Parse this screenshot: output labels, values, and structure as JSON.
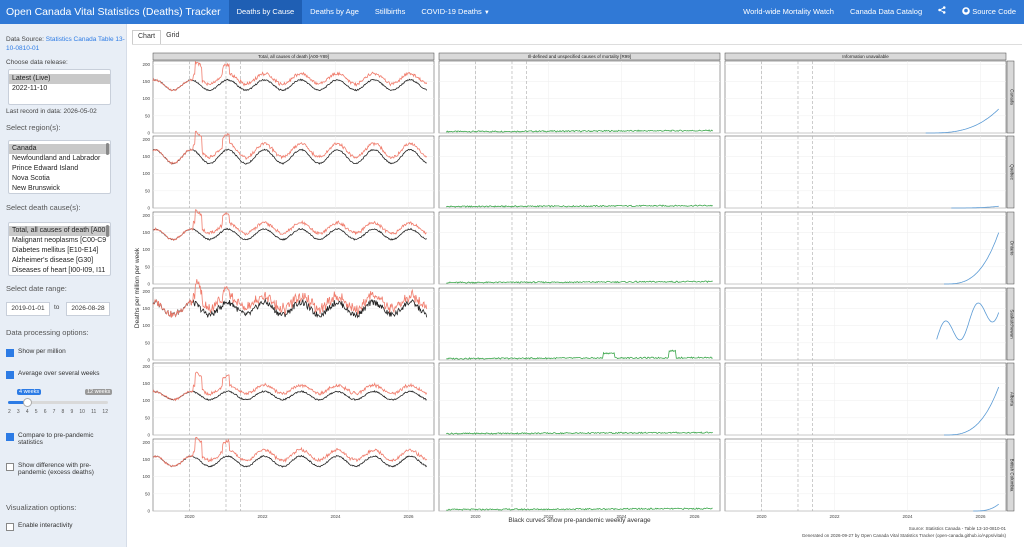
{
  "navbar": {
    "brand": "Open Canada Vital Statistics (Deaths) Tracker",
    "items": [
      "Deaths by Cause",
      "Deaths by Age",
      "Stillbirths",
      "COVID-19 Deaths"
    ],
    "right": [
      "World-wide Mortality Watch",
      "Canada Data Catalog"
    ],
    "source_code": "Source Code"
  },
  "sidebar": {
    "data_source_label": "Data Source:",
    "data_source_link_1": "Statistics Canada Table 13-",
    "data_source_link_2": "10-0810-01",
    "release_label": "Choose data release:",
    "releases": [
      "Latest (Live)",
      "2022-11-10"
    ],
    "last_record": "Last record in data: 2026-05-02",
    "region_label": "Select region(s):",
    "regions": [
      "Canada",
      "Newfoundland and Labrador",
      "Prince Edward Island",
      "Nova Scotia",
      "New Brunswick"
    ],
    "cause_label": "Select death cause(s):",
    "causes": [
      "Total, all causes of death [A00",
      "Malignant neoplasms [C00-C9",
      "Diabetes mellitus [E10-E14]",
      "Alzheimer's disease [G30]",
      "Diseases of heart [I00-I09, I11"
    ],
    "date_label": "Select date range:",
    "date_from": "2019-01-01",
    "date_to_word": "to",
    "date_to": "2026-08-28",
    "processing_label": "Data processing options:",
    "per_million": "Show per million",
    "average": "Average over several weeks",
    "slider_value": "4 weeks",
    "slider_max": "12 weeks",
    "slider_ticks": [
      "2",
      "3",
      "4",
      "5",
      "6",
      "7",
      "8",
      "9",
      "10",
      "11",
      "12"
    ],
    "compare_1": "Compare to pre-pandemic",
    "compare_2": "statistics",
    "diff_1": "Show difference with pre-",
    "diff_2": "pandemic (excess deaths)",
    "viz_label": "Visualization options:",
    "interactivity": "Enable interactivity"
  },
  "tabs": [
    "Chart",
    "Grid"
  ],
  "chart_data": {
    "type": "line",
    "facet_columns": [
      "Total, all causes of death [A00-Y89]",
      "Ill-defined and unspecified causes of mortality [R99]",
      "Information unavailable"
    ],
    "facet_rows": [
      "Canada",
      "Quebec",
      "Ontario",
      "Saskatchewan",
      "Alberta",
      "British Columbia"
    ],
    "ylabel": "Deaths per million per week",
    "xlabel": "Black curves show pre-pandemic weekly average",
    "x_ticks": [
      "2020",
      "2022",
      "2024",
      "2026"
    ],
    "y_ticks": [
      "0",
      "50",
      "100",
      "150",
      "200"
    ],
    "ylim": [
      0,
      210
    ],
    "xlim": [
      2019.0,
      2026.7
    ],
    "vlines": [
      2020.0,
      2021.0,
      2021.4
    ],
    "colors": {
      "observed": "#f07c6c",
      "baseline": "#222222",
      "ill_defined": "#3aa64a",
      "unavailable": "#5b9bd5",
      "vline": "#aaaaaa"
    },
    "source_1": "Source: Statistics Canada - Table 13-10-0810-01",
    "source_2": "Generated on 2026-09-27 by Open Canada Vital Statistics Tracker (open-canada.github.io/Apps/vitals)"
  }
}
